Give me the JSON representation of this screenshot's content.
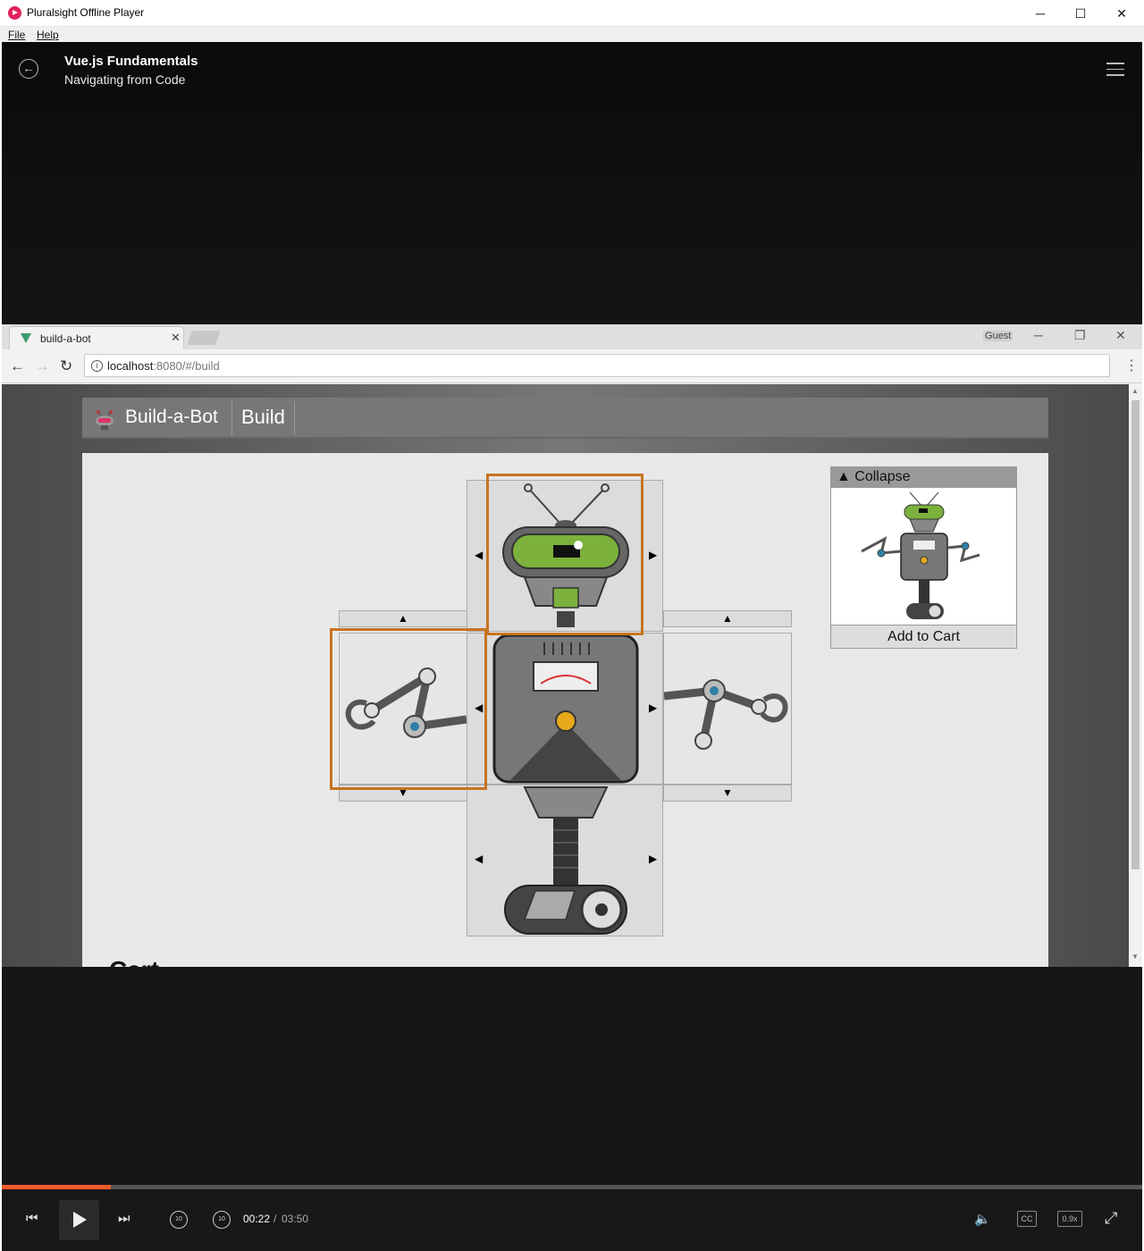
{
  "window": {
    "title": "Pluralsight Offline Player",
    "minimize": "─",
    "maximize": "☐",
    "close": "✕"
  },
  "menu": {
    "file": "File",
    "help": "Help"
  },
  "player": {
    "course_title": "Vue.js Fundamentals",
    "module_title": "Navigating from Code",
    "back_icon": "←"
  },
  "browser": {
    "tab_title": "build-a-bot",
    "tab_close": "✕",
    "profile": "Guest",
    "url_host": "localhost",
    "url_path": ":8080/#/build",
    "back": "←",
    "forward": "→",
    "reload": "↻",
    "menu": "⋮",
    "win_min": "─",
    "win_max": "❐",
    "win_close": "✕"
  },
  "app": {
    "brand": "Build-a-Bot",
    "nav_build": "Build",
    "collapse": "▲ Collapse",
    "add_to_cart": "Add to Cart",
    "cart_heading": "Cart",
    "arrow_up": "▲",
    "arrow_down": "▼",
    "arrow_left": "◀",
    "arrow_right": "▶"
  },
  "controls": {
    "current_time": "00:22",
    "separator": "/",
    "total_time": "03:50",
    "progress_fraction": 0.096,
    "rewind": "10",
    "forward": "10",
    "cc": "CC",
    "speed": "0.9x",
    "prev": "⏮",
    "next": "⏭",
    "volume": "🔈",
    "fullscreen": "⤢"
  },
  "colors": {
    "accent": "#f15b2a",
    "highlight": "#c8731f"
  }
}
